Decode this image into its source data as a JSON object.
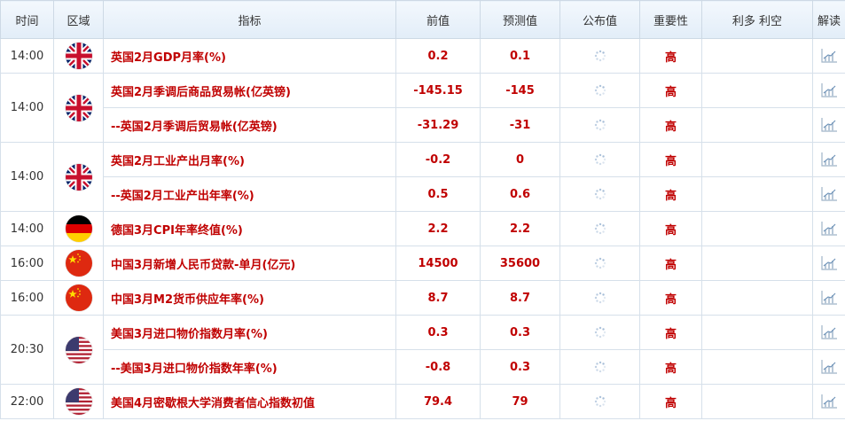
{
  "header": {
    "time": "时间",
    "region": "区域",
    "indicator": "指标",
    "previous": "前值",
    "forecast": "预测值",
    "published": "公布值",
    "importance": "重要性",
    "bull_bear": "利多 利空",
    "analysis": "解读"
  },
  "rows": [
    {
      "time": "14:00",
      "country": "uk",
      "indicator": "英国2月GDP月率(%)",
      "previous": "0.2",
      "forecast": "0.1",
      "importance": "高"
    },
    {
      "time": "14:00",
      "country": "uk",
      "indicator": "英国2月季调后商品贸易帐(亿英镑)",
      "previous": "-145.15",
      "forecast": "-145",
      "importance": "高"
    },
    {
      "indicator": "--英国2月季调后贸易帐(亿英镑)",
      "previous": "-31.29",
      "forecast": "-31",
      "importance": "高"
    },
    {
      "time": "14:00",
      "country": "uk",
      "indicator": "英国2月工业产出月率(%)",
      "previous": "-0.2",
      "forecast": "0",
      "importance": "高"
    },
    {
      "indicator": "--英国2月工业产出年率(%)",
      "previous": "0.5",
      "forecast": "0.6",
      "importance": "高"
    },
    {
      "time": "14:00",
      "country": "germany",
      "indicator": "德国3月CPI年率终值(%)",
      "previous": "2.2",
      "forecast": "2.2",
      "importance": "高"
    },
    {
      "time": "16:00",
      "country": "china",
      "indicator": "中国3月新增人民币贷款-单月(亿元)",
      "previous": "14500",
      "forecast": "35600",
      "importance": "高"
    },
    {
      "time": "16:00",
      "country": "china",
      "indicator": "中国3月M2货币供应年率(%)",
      "previous": "8.7",
      "forecast": "8.7",
      "importance": "高"
    },
    {
      "time": "20:30",
      "country": "us",
      "indicator": "美国3月进口物价指数月率(%)",
      "previous": "0.3",
      "forecast": "0.3",
      "importance": "高"
    },
    {
      "indicator": "--美国3月进口物价指数年率(%)",
      "previous": "-0.8",
      "forecast": "0.3",
      "importance": "高"
    },
    {
      "time": "22:00",
      "country": "us",
      "indicator": "美国4月密歇根大学消费者信心指数初值",
      "previous": "79.4",
      "forecast": "79",
      "importance": "高"
    }
  ],
  "colors": {
    "value_red": "#c00000",
    "header_bg": "#e2edf8",
    "border": "#d6e0ea"
  },
  "icons": {
    "published": "loading-spinner-icon",
    "analysis": "chart-icon"
  }
}
